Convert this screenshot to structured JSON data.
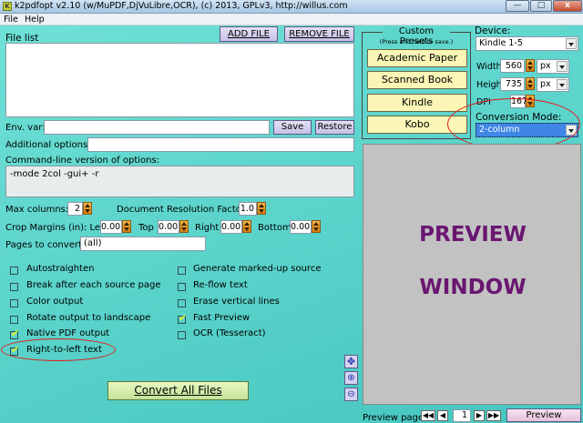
{
  "window": {
    "title": "k2pdfopt v2.10 (w/MuPDF,DjVuLibre,OCR), (c) 2013, GPLv3, http://willus.com",
    "controls": {
      "minimize": "—",
      "maximize": "□",
      "close": "x"
    }
  },
  "menu": {
    "file": "File",
    "help": "Help"
  },
  "filelist": {
    "label": "File list",
    "add": "ADD FILE",
    "remove": "REMOVE FILE"
  },
  "envvar": {
    "label": "Env. var:",
    "value": "",
    "save": "Save",
    "restore": "Restore"
  },
  "additional": {
    "label": "Additional options:",
    "value": ""
  },
  "cmdline": {
    "label": "Command-line version of options:",
    "value": "-mode 2col -gui+ -r"
  },
  "maxcolumns": {
    "label": "Max columns:",
    "value": "2"
  },
  "docres": {
    "label": "Document Resolution Factor:",
    "value": "1.0"
  },
  "crop": {
    "label": "Crop Margins (in): Left",
    "left": "0.00",
    "top_label": "Top",
    "top": "0.00",
    "right_label": "Right",
    "right": "0.00",
    "bottom_label": "Bottom",
    "bottom": "0.00"
  },
  "pages": {
    "label": "Pages to convert:",
    "value": "(all)"
  },
  "options_left": [
    {
      "label": "Autostraighten",
      "checked": false
    },
    {
      "label": "Break after each source page",
      "checked": false
    },
    {
      "label": "Color output",
      "checked": false
    },
    {
      "label": "Rotate output to landscape",
      "checked": false
    },
    {
      "label": "Native PDF output",
      "checked": true
    },
    {
      "label": "Right-to-left text",
      "checked": true
    }
  ],
  "options_right": [
    {
      "label": "Generate marked-up source",
      "checked": false
    },
    {
      "label": "Re-flow text",
      "checked": false
    },
    {
      "label": "Erase vertical lines",
      "checked": false
    },
    {
      "label": "Fast Preview",
      "checked": true
    },
    {
      "label": "OCR (Tesseract)",
      "checked": false
    }
  ],
  "convert": "Convert All Files",
  "presets": {
    "title": "Custom Presets",
    "subtitle": "(Press and hold to save.)",
    "items": [
      "Academic Paper",
      "Scanned Book",
      "Kindle",
      "Kobo"
    ]
  },
  "device": {
    "label": "Device:",
    "value": "Kindle 1-5",
    "width_label": "Width",
    "width": "560",
    "width_unit": "px",
    "height_label": "Height",
    "height": "735",
    "height_unit": "px",
    "dpi_label": "DPI",
    "dpi": "167"
  },
  "conversion": {
    "label": "Conversion Mode:",
    "value": "2-column"
  },
  "preview": {
    "line1": "PREVIEW",
    "line2": "WINDOW",
    "page_label": "Preview page:",
    "page": "1",
    "button": "Preview"
  },
  "colors": {
    "background": "#5ed6cc",
    "button": "#c6c0e6",
    "preset": "#fbf6b6",
    "preview_text": "#6a1670",
    "highlight": "#e21a1a"
  }
}
